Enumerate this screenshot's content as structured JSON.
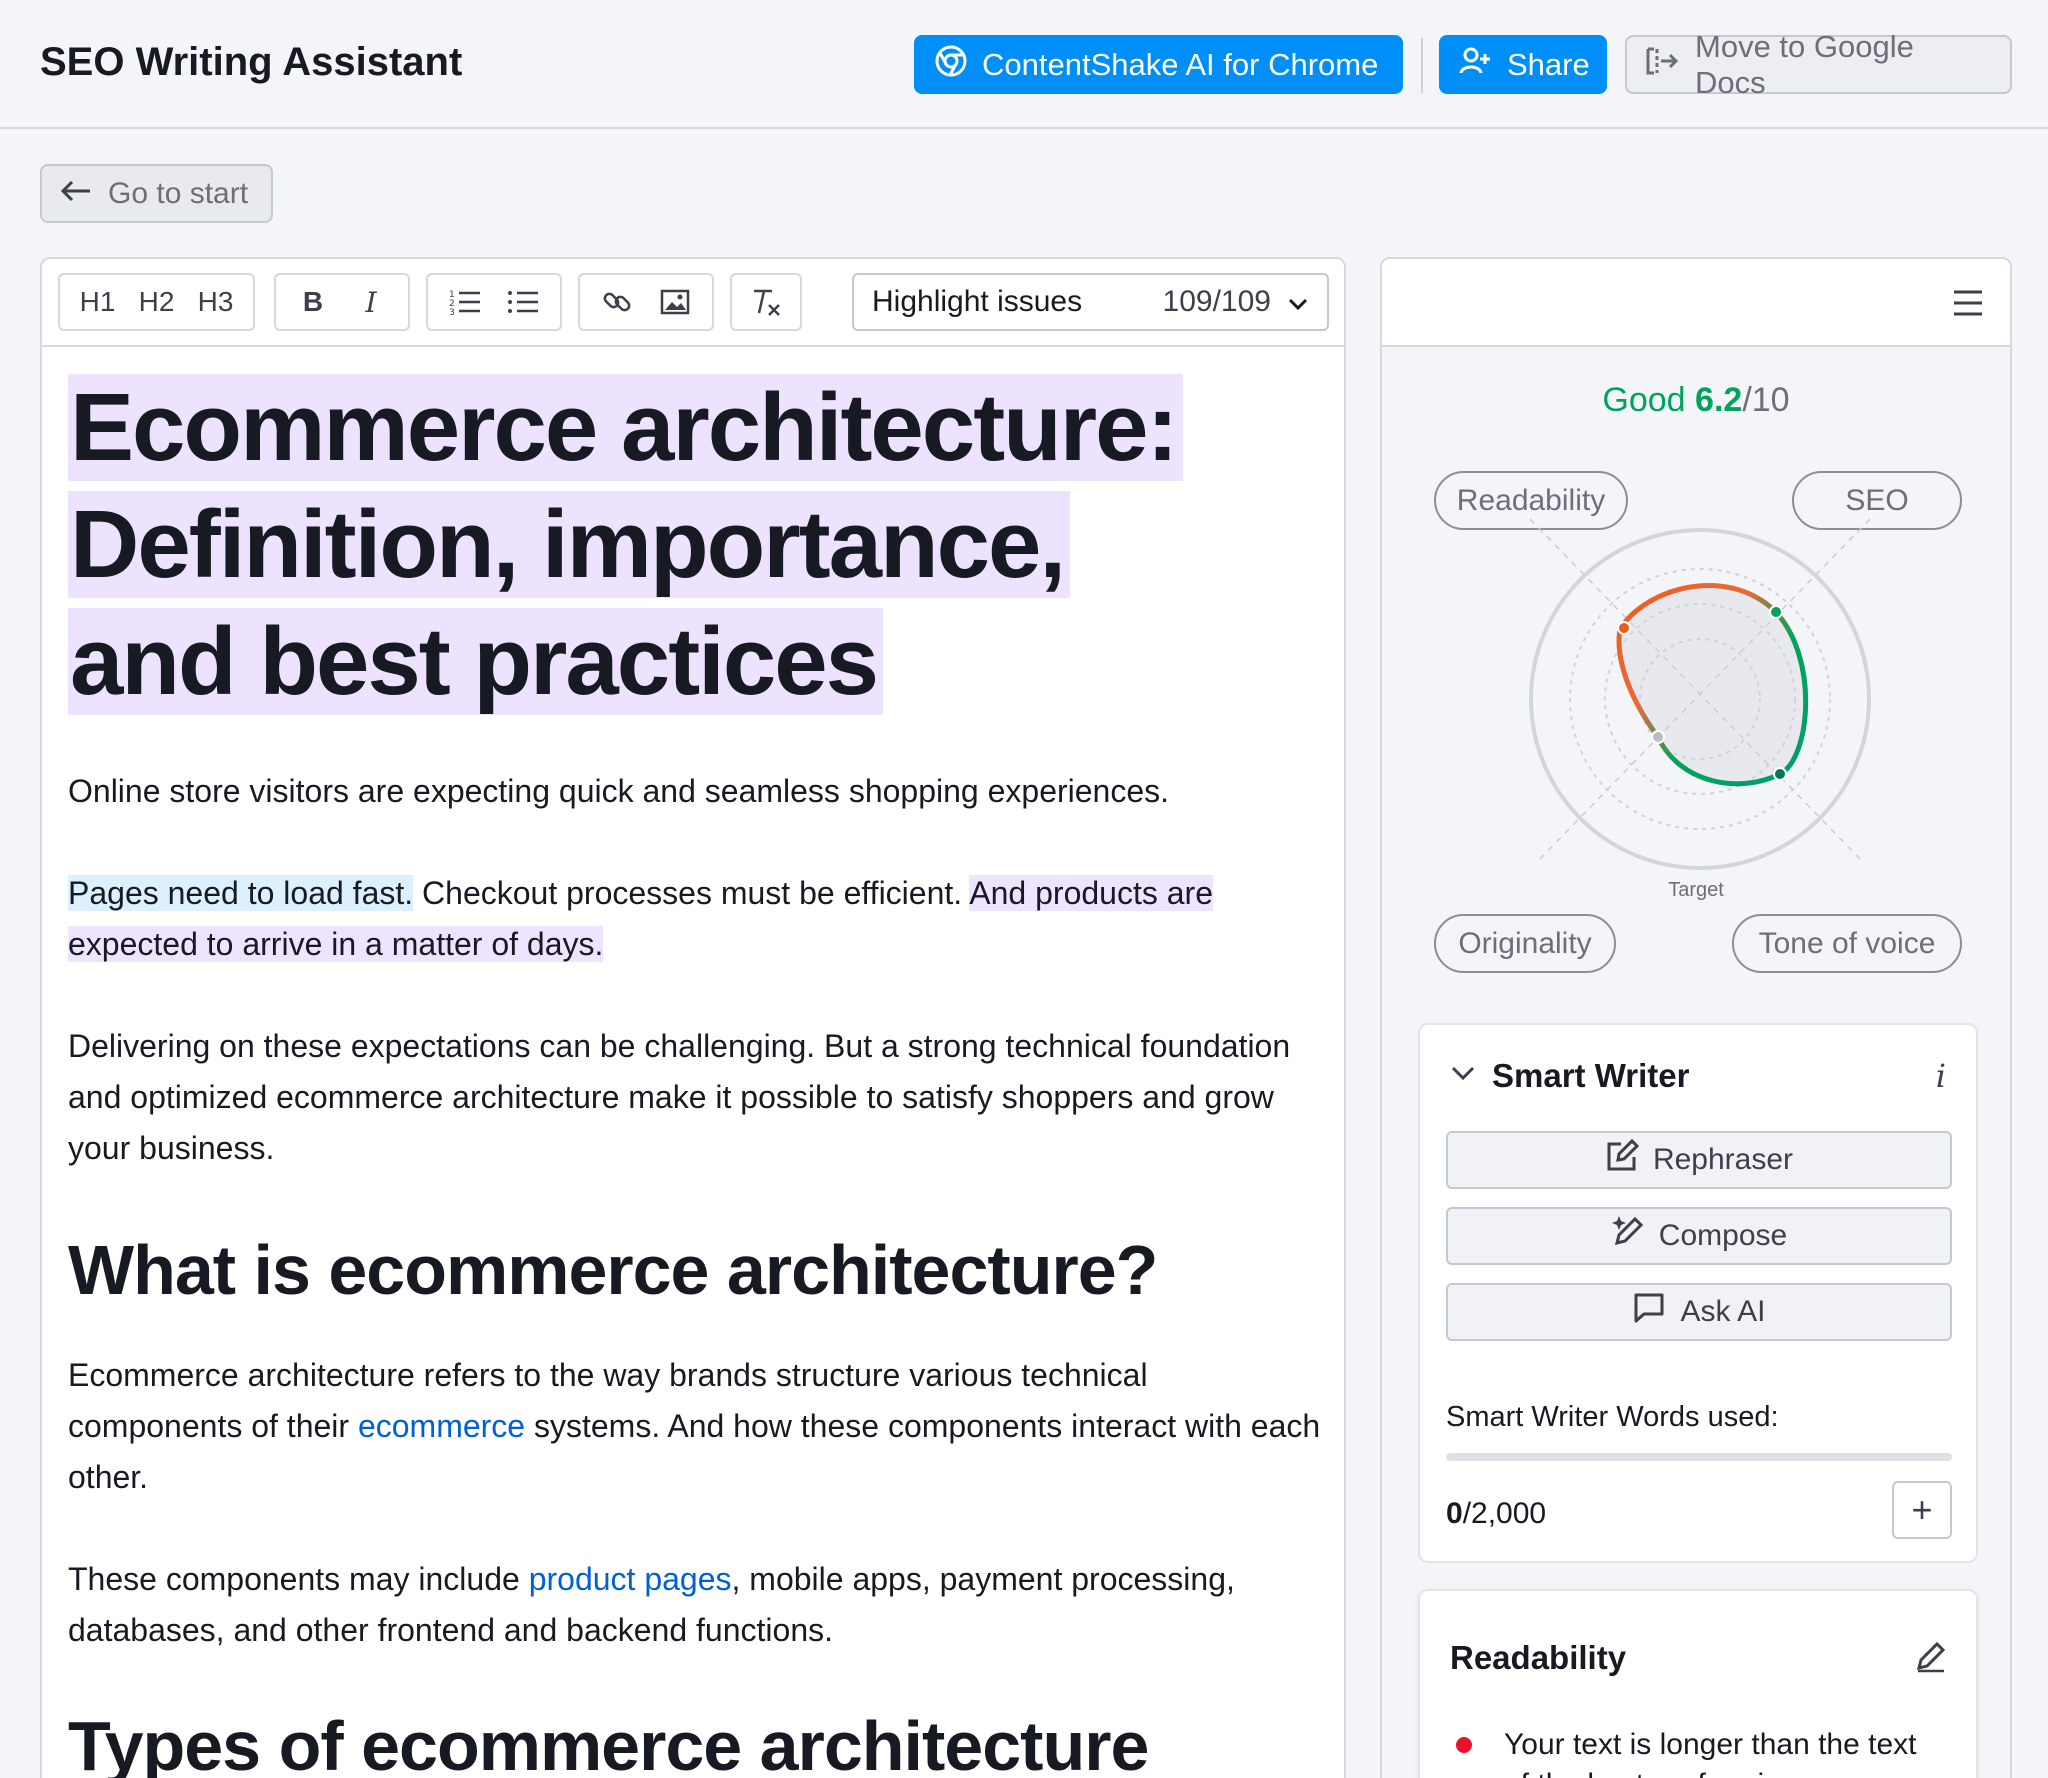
{
  "header": {
    "title": "SEO Writing Assistant",
    "contentshake_label": "ContentShake AI for Chrome",
    "share_label": "Share",
    "gdocs_label": "Move to Google Docs"
  },
  "nav": {
    "go_to_start": "Go to start"
  },
  "toolbar": {
    "h1": "H1",
    "h2": "H2",
    "h3": "H3",
    "bold": "B",
    "italic": "I",
    "highlight_label": "Highlight issues",
    "highlight_count": "109/109"
  },
  "document": {
    "title_lines": [
      "Ecommerce architecture:",
      "Definition, importance,",
      "and best practices"
    ],
    "p1": "Online store visitors are expecting quick and seamless shopping experiences.",
    "p2_a": "Pages need to load fast.",
    "p2_b": " Checkout processes must be efficient. ",
    "p2_c": "And products are expected to arrive in a matter of days.",
    "p3": "Delivering on these expectations can be challenging. But a strong technical foundation and optimized ecommerce architecture make it possible to satisfy shoppers and grow your business.",
    "h2_1": "What is ecommerce architecture?",
    "p4_a": "Ecommerce architecture refers to the way brands structure various technical components of their ",
    "p4_link": "ecommerce",
    "p4_b": " systems. And how these components interact with each other.",
    "p5_a": "These components may include ",
    "p5_link": "product pages",
    "p5_b": ", mobile apps, payment processing, databases, and other frontend and backend functions.",
    "h2_2": "Types of ecommerce architecture"
  },
  "score": {
    "label": "Good",
    "value": "6.2",
    "denominator": "/10",
    "target_label": "Target",
    "axes": [
      "Readability",
      "SEO",
      "Originality",
      "Tone of voice"
    ]
  },
  "smart_writer": {
    "title": "Smart Writer",
    "info": "i",
    "rephraser": "Rephraser",
    "compose": "Compose",
    "ask_ai": "Ask AI",
    "words_used_label": "Smart Writer Words used:",
    "used": "0",
    "limit": "/2,000",
    "usage_fraction": 0
  },
  "readability": {
    "title": "Readability",
    "item1": "Your text is longer than the text of the best-performing"
  },
  "colors": {
    "accent": "#008ff8",
    "good": "#00a35b",
    "highlight_purple": "#ede3ff",
    "highlight_blue": "#dcf0ff",
    "error": "#e8122d"
  },
  "icons": [
    "chrome-icon",
    "add-user-icon",
    "export-icon",
    "arrow-left-icon",
    "link-icon",
    "image-icon",
    "clear-format-icon",
    "chevron-down-icon",
    "menu-icon",
    "edit-icon",
    "sparkle-pen-icon",
    "chat-icon",
    "pencil-icon"
  ]
}
